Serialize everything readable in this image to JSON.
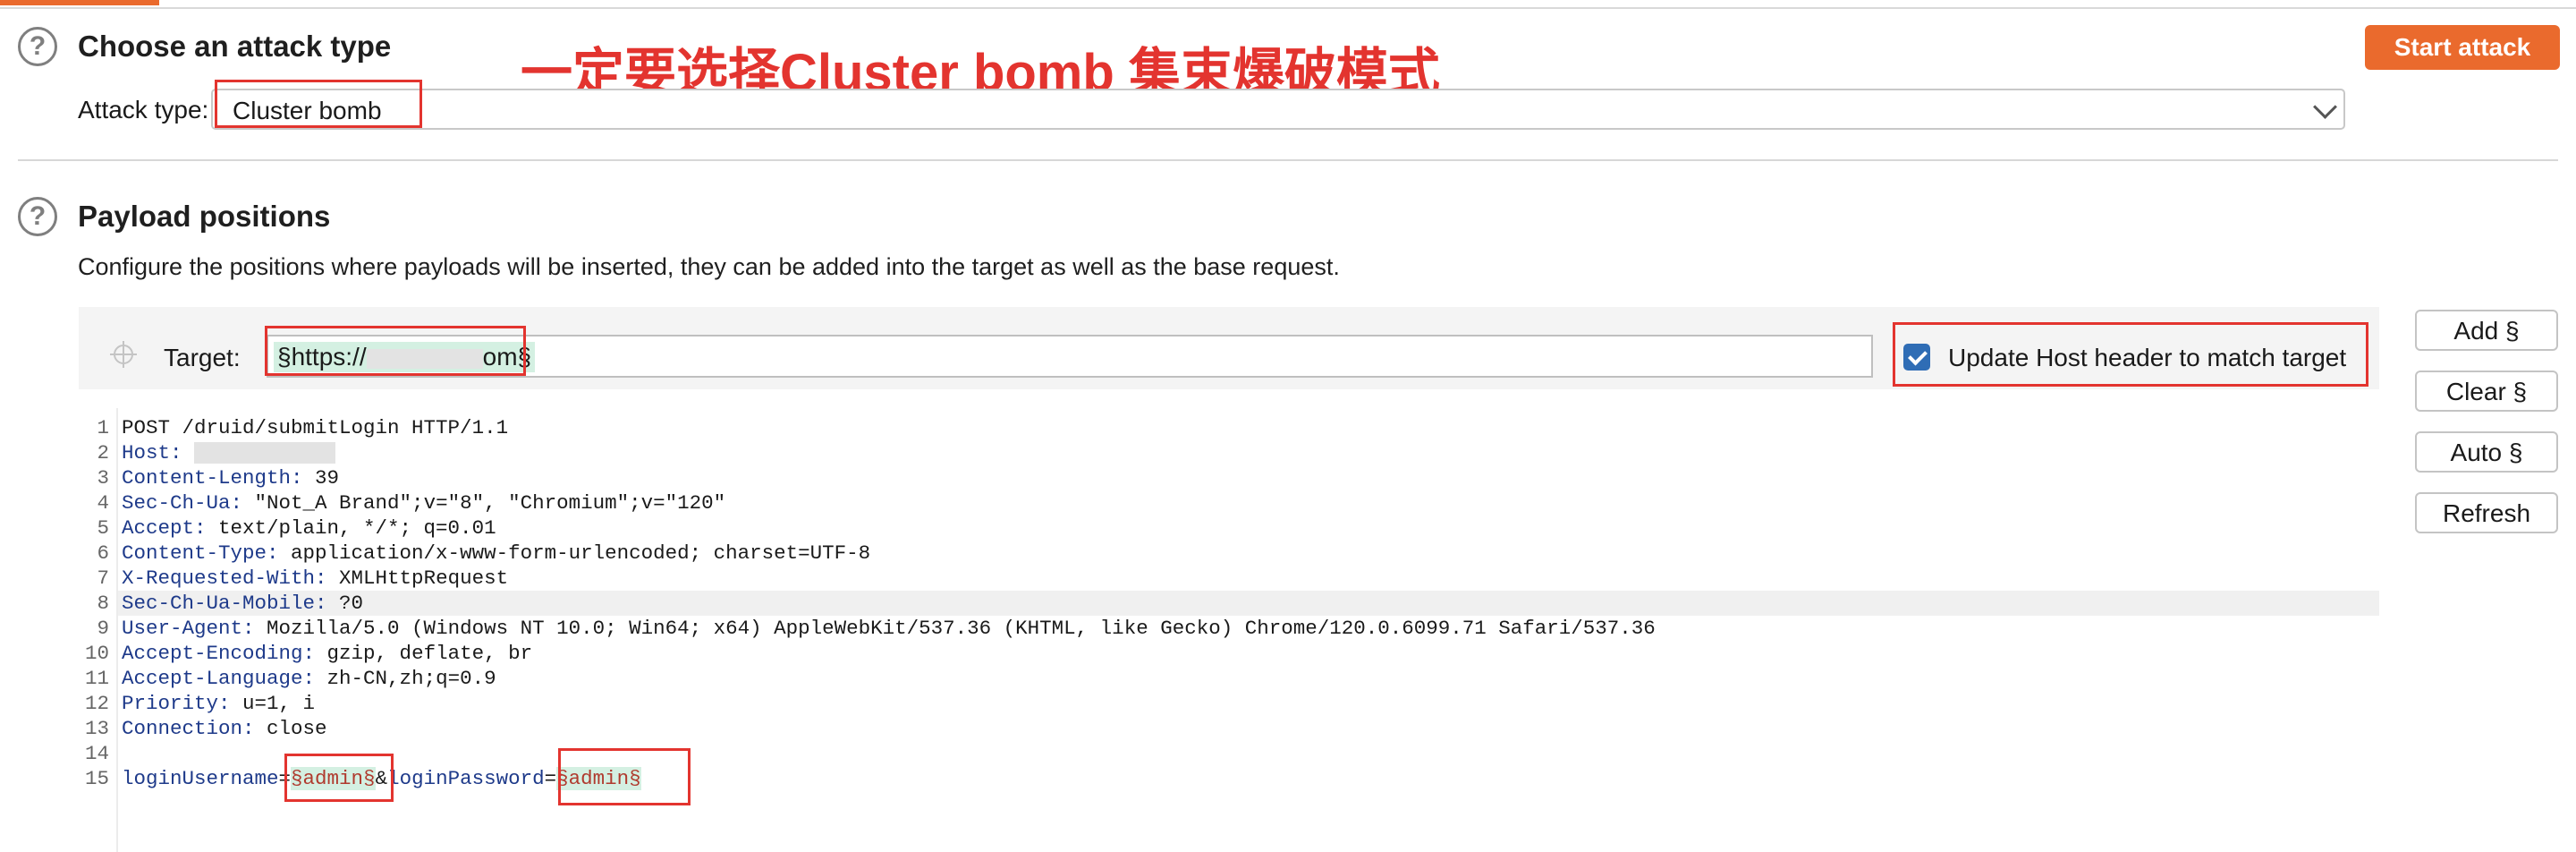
{
  "annotation": "一定要选择Cluster bomb 集束爆破模式",
  "attack": {
    "title": "Choose an attack type",
    "start_label": "Start attack",
    "type_label": "Attack type:",
    "type_value": "Cluster bomb"
  },
  "positions": {
    "title": "Payload positions",
    "description": "Configure the positions where payloads will be inserted, they can be added into the target as well as the base request.",
    "target_label": "Target:",
    "target_prefix": "§https://",
    "target_suffix": "om§",
    "update_host_label": "Update Host header to match target",
    "update_host_checked": true,
    "buttons": [
      "Add §",
      "Clear §",
      "Auto §",
      "Refresh"
    ]
  },
  "request": {
    "lines": [
      {
        "n": "1",
        "k": "",
        "v": "POST /druid/submitLogin HTTP/1.1"
      },
      {
        "n": "2",
        "k": "Host:",
        "v": " "
      },
      {
        "n": "3",
        "k": "Content-Length:",
        "v": " 39"
      },
      {
        "n": "4",
        "k": "Sec-Ch-Ua:",
        "v": " \"Not_A Brand\";v=\"8\", \"Chromium\";v=\"120\""
      },
      {
        "n": "5",
        "k": "Accept:",
        "v": " text/plain, */*; q=0.01"
      },
      {
        "n": "6",
        "k": "Content-Type:",
        "v": " application/x-www-form-urlencoded; charset=UTF-8"
      },
      {
        "n": "7",
        "k": "X-Requested-With:",
        "v": " XMLHttpRequest"
      },
      {
        "n": "8",
        "k": "Sec-Ch-Ua-Mobile:",
        "v": " ?0"
      },
      {
        "n": "9",
        "k": "User-Agent:",
        "v": " Mozilla/5.0 (Windows NT 10.0; Win64; x64) AppleWebKit/537.36 (KHTML, like Gecko) Chrome/120.0.6099.71 Safari/537.36"
      },
      {
        "n": "10",
        "k": "Accept-Encoding:",
        "v": " gzip, deflate, br"
      },
      {
        "n": "11",
        "k": "Accept-Language:",
        "v": " zh-CN,zh;q=0.9"
      },
      {
        "n": "12",
        "k": "Priority:",
        "v": " u=1, i"
      },
      {
        "n": "13",
        "k": "Connection:",
        "v": " close"
      },
      {
        "n": "14",
        "k": "",
        "v": ""
      }
    ],
    "body": {
      "n": "15",
      "k1": "loginUsername",
      "eq1": "=",
      "p1": "§admin§",
      "amp": "&",
      "k2": "loginPassword",
      "eq2": "=",
      "p2": "§admin§"
    }
  },
  "colors": {
    "accent": "#ea6a2d",
    "annotation_red": "#e3342f",
    "checkbox_blue": "#2f6db5",
    "payload_bg": "#d4f0e2"
  }
}
